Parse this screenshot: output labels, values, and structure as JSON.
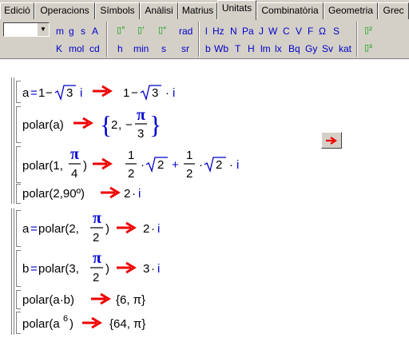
{
  "tabs": [
    "Edició",
    "Operacions",
    "Símbols",
    "Anàlisi",
    "Matrius",
    "Unitats",
    "Combinatòria",
    "Geometria",
    "Grec"
  ],
  "active_tab": "Unitats",
  "toolbar": {
    "row1": [
      "m",
      "g",
      "s",
      "A",
      "°",
      "′",
      "″",
      "rad",
      "l",
      "Hz",
      "N",
      "Pa",
      "J",
      "W",
      "C",
      "V",
      "F",
      "Ω",
      "S",
      "²"
    ],
    "row2": [
      "K",
      "mol",
      "cd",
      "h",
      "min",
      "s",
      "sr",
      "b",
      "Wb",
      "T",
      "H",
      "lm",
      "lx",
      "Bq",
      "Gy",
      "Sv",
      "kat",
      "³"
    ]
  },
  "expressions": [
    {
      "input": "a=1− √3 i",
      "result": "1− √3 · i"
    },
    {
      "input": "polar(a)",
      "result": "{2, − π/3}"
    },
    {
      "input": "polar(1, π/4)",
      "result": "1/2 · √2 + 1/2 · √2 · i"
    },
    {
      "input": "polar(2,90º)",
      "result": "2 · i"
    },
    {
      "input": "a=polar(2, π/2)",
      "result": "2 · i"
    },
    {
      "input": "b=polar(3, π/2)",
      "result": "3 · i"
    },
    {
      "input": "polar(a·b)",
      "result": "{6, π}"
    },
    {
      "input": "polar(a⁶)",
      "result": "{64, π}"
    }
  ],
  "t": {
    "a": "a",
    "eq": "=",
    "one": "1",
    "minus": "−",
    "three": "3",
    "i": "i",
    "dot": "·",
    "polar_a": "polar(a)",
    "brace_l": "{",
    "brace_r": "}",
    "two": "2",
    "comma": ",",
    "pi": "π",
    "polar1_open": "polar(1,",
    "close": ")",
    "four": "4",
    "plus": "+",
    "polar_2_90": "polar(2,90º)",
    "apolar": "polar(2,",
    "b": "b",
    "bpolar": "polar(3,",
    "polar_ab": "polar(a·b)",
    "six_pi": "{6, π}",
    "polar_a_pre": "polar(a",
    "sup6": "6",
    "polar_a_post": ")",
    "sixtyfour_pi": "{64, π}"
  },
  "arrow_color": "#ee0000"
}
